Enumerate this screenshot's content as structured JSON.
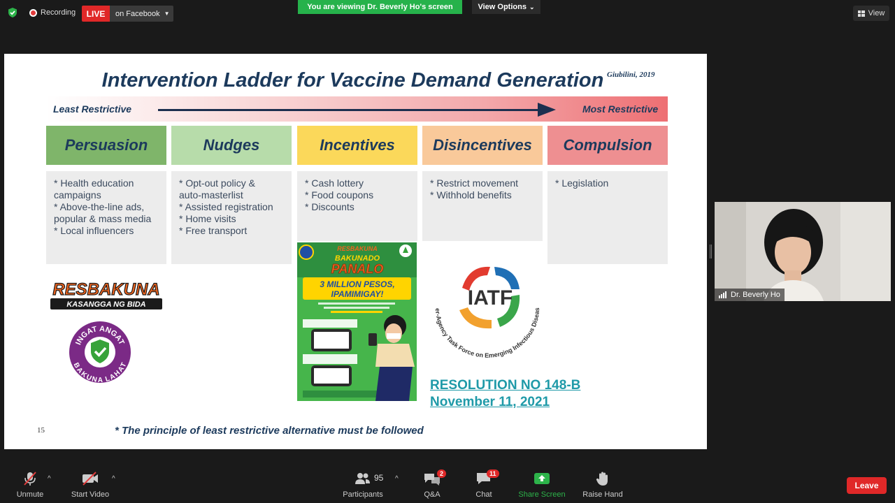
{
  "topbar": {
    "recording_label": "Recording",
    "live_label": "LIVE",
    "live_destination": "on Facebook",
    "viewing_banner": "You are viewing Dr. Beverly Ho's screen",
    "view_options_label": "View Options",
    "view_label": "View"
  },
  "slide": {
    "title": "Intervention Ladder for Vaccine Demand Generation",
    "citation": "Giubilini, 2019",
    "least_label": "Least Restrictive",
    "most_label": "Most Restrictive",
    "categories": [
      {
        "name": "Persuasion",
        "color": "#7fb56a",
        "items": [
          "* Health education",
          "campaigns",
          "* Above-the-line ads,",
          "popular & mass media",
          "* Local influencers"
        ]
      },
      {
        "name": "Nudges",
        "color": "#b7dcaa",
        "items": [
          "* Opt-out policy &",
          "auto-masterlist",
          "* Assisted registration",
          "* Home visits",
          "* Free transport"
        ]
      },
      {
        "name": "Incentives",
        "color": "#fbd85a",
        "items": [
          "* Cash lottery",
          "* Food coupons",
          "* Discounts"
        ]
      },
      {
        "name": "Disincentives",
        "color": "#f9c99a",
        "items": [
          "* Restrict movement",
          "* Withhold benefits"
        ]
      },
      {
        "name": "Compulsion",
        "color": "#ee8f91",
        "items": [
          "* Legislation"
        ]
      }
    ],
    "resbakuna_logo": {
      "line1": "RESBAKUNA",
      "line2": "KASANGGA NG BIDA"
    },
    "ingat_logo": {
      "top": "INGAT ANGAT",
      "bottom": "BAKUNA LAHAT"
    },
    "poster": {
      "top": "RESBAKUNA",
      "headline1": "BAKUNADO",
      "headline2": "PANALO",
      "banner1": "3 MILLION PESOS,",
      "banner2": "IPAMIMIGAY!"
    },
    "iatf_logo": {
      "center": "IATF",
      "ring_text": "Inter-Agency Task Force on Emerging Infectious Diseases"
    },
    "resolution_line1": "RESOLUTION NO 148-B",
    "resolution_line2": "November 11, 2021",
    "page_number": "15",
    "footnote": "* The principle of least restrictive alternative must be followed"
  },
  "video": {
    "participant_name": "Dr. Beverly Ho"
  },
  "toolbar": {
    "unmute": "Unmute",
    "start_video": "Start Video",
    "participants": "Participants",
    "participants_count": "95",
    "qa": "Q&A",
    "qa_badge": "2",
    "chat": "Chat",
    "chat_badge": "11",
    "share_screen": "Share Screen",
    "raise_hand": "Raise Hand",
    "leave": "Leave"
  }
}
